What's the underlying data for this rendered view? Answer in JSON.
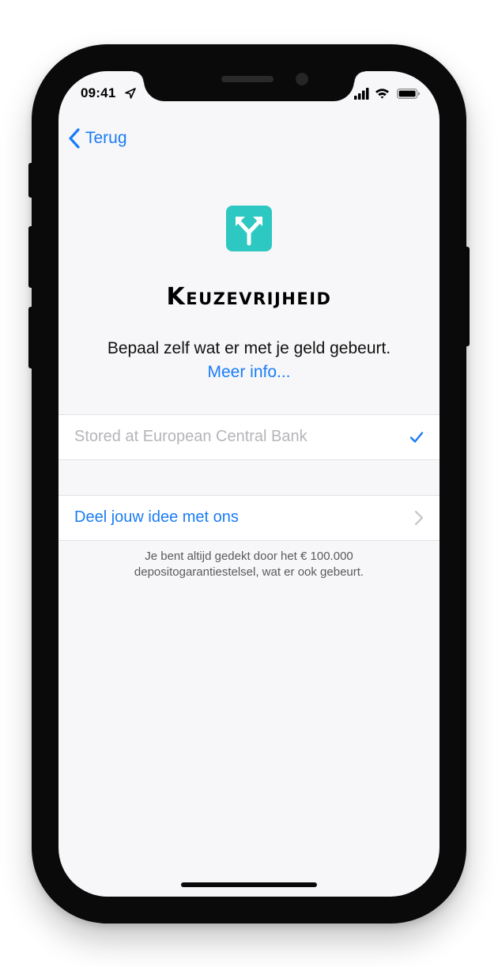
{
  "status_bar": {
    "time": "09:41"
  },
  "nav": {
    "back_label": "Terug"
  },
  "title": "Keuzevrijheid",
  "subtitle": {
    "text": "Bepaal zelf wat er met je geld gebeurt. ",
    "link": "Meer info..."
  },
  "options": {
    "bank_label": "Stored at European Central Bank",
    "bank_selected": true,
    "idea_label": "Deel jouw idee met ons"
  },
  "footnote": "Je bent altijd gedekt door het € 100.000 depositogarantiestelsel, wat er ook gebeurt.",
  "colors": {
    "accent": "#1a7cf5",
    "app_icon": "#2ec8c2",
    "background": "#f7f7f9"
  },
  "icons": {
    "app": "split-arrows-icon",
    "back": "chevron-left-icon",
    "check": "checkmark-icon",
    "disclosure": "chevron-right-icon"
  }
}
